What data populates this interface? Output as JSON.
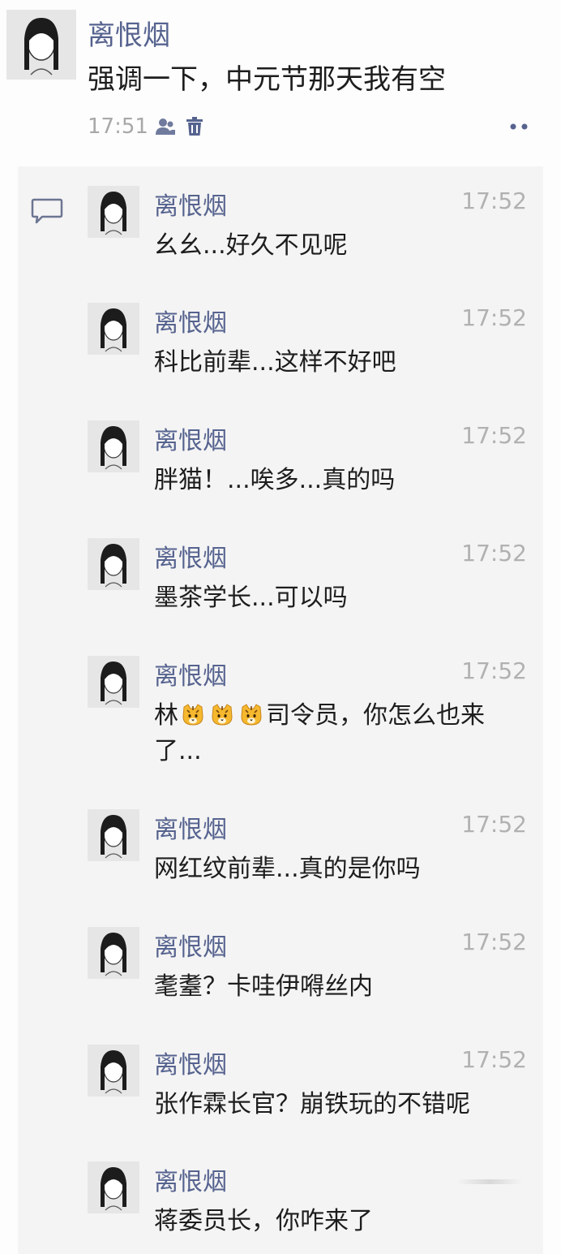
{
  "post": {
    "author": "离恨烟",
    "text": "强调一下，中元节那天我有空",
    "time": "17:51",
    "icons": [
      "contacts-icon",
      "trash-icon",
      "more-icon"
    ]
  },
  "comments": [
    {
      "author": "离恨烟",
      "time": "17:52",
      "text": "幺幺...好久不见呢"
    },
    {
      "author": "离恨烟",
      "time": "17:52",
      "text": "科比前辈...这样不好吧"
    },
    {
      "author": "离恨烟",
      "time": "17:52",
      "text": "胖猫！...唉多...真的吗"
    },
    {
      "author": "离恨烟",
      "time": "17:52",
      "text": "墨茶学长...可以吗"
    },
    {
      "author": "离恨烟",
      "time": "17:52",
      "text_before": "林",
      "emoji_count": 3,
      "emoji_icon": "tiger-face-emoji",
      "text_after": "司令员，你怎么也来了..."
    },
    {
      "author": "离恨烟",
      "time": "17:52",
      "text": "网红纹前辈...真的是你吗"
    },
    {
      "author": "离恨烟",
      "time": "17:52",
      "text": "耄耋？卡哇伊嘚丝内"
    },
    {
      "author": "离恨烟",
      "time": "17:52",
      "text": "张作霖长官？崩铁玩的不错呢"
    },
    {
      "author": "离恨烟",
      "time": "",
      "text": "蒋委员长，你咋来了"
    }
  ]
}
